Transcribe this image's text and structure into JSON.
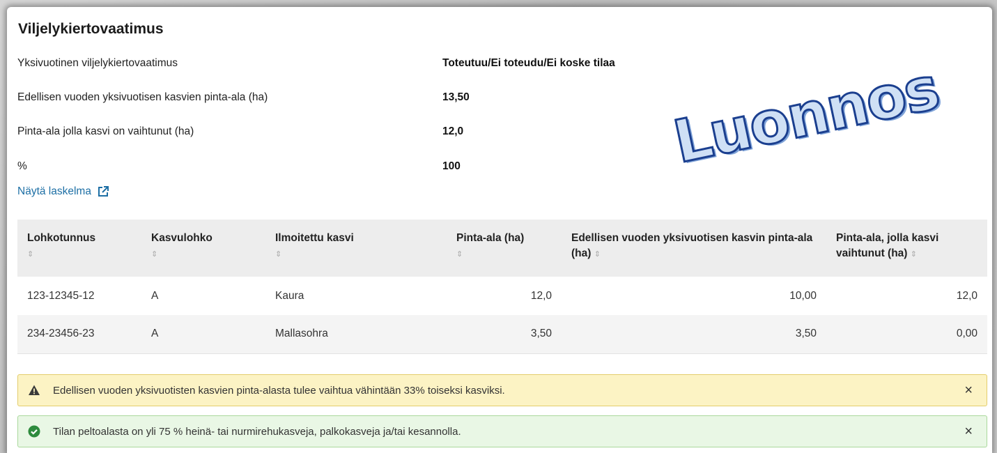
{
  "section": {
    "title": "Viljelykiertovaatimus",
    "rows": [
      {
        "label": "Yksivuotinen viljelykiertovaatimus",
        "value": "Toteutuu/Ei toteudu/Ei koske tilaa"
      },
      {
        "label": "Edellisen vuoden yksivuotisen kasvien pinta-ala (ha)",
        "value": "13,50"
      },
      {
        "label": "Pinta-ala jolla kasvi on vaihtunut (ha)",
        "value": "12,0"
      },
      {
        "label": "%",
        "value": "100"
      }
    ],
    "link_label": "Näytä laskelma",
    "link_icon": "external-link-icon"
  },
  "watermark": "Luonnos",
  "table": {
    "headers": [
      {
        "label": "Lohkotunnus"
      },
      {
        "label": "Kasvulohko"
      },
      {
        "label": "Ilmoitettu kasvi"
      },
      {
        "label": "Pinta-ala (ha)"
      },
      {
        "label": "Edellisen vuoden yksivuotisen kasvin pinta-ala (ha)"
      },
      {
        "label": "Pinta-ala, jolla kasvi vaihtunut (ha)"
      }
    ],
    "rows": [
      [
        "123-12345-12",
        "A",
        "Kaura",
        "12,0",
        "10,00",
        "12,0"
      ],
      [
        "234-23456-23",
        "A",
        "Mallasohra",
        "3,50",
        "3,50",
        "0,00"
      ]
    ]
  },
  "alerts": {
    "warning": {
      "text": "Edellisen vuoden yksivuotisten kasvien pinta-alasta tulee vaihtua vähintään 33% toiseksi kasviksi.",
      "icon": "warning-triangle-icon",
      "close": "×"
    },
    "success": {
      "text": "Tilan peltoalasta on yli 75 % heinä- tai nurmirehukasveja, palkokasveja ja/tai kesannolla.",
      "icon": "check-circle-icon",
      "close": "×"
    }
  },
  "colors": {
    "link": "#1d6fa5",
    "warning_bg": "#fcf3c4",
    "success_bg": "#e9f7e5",
    "success_icon": "#2e8b3d"
  }
}
